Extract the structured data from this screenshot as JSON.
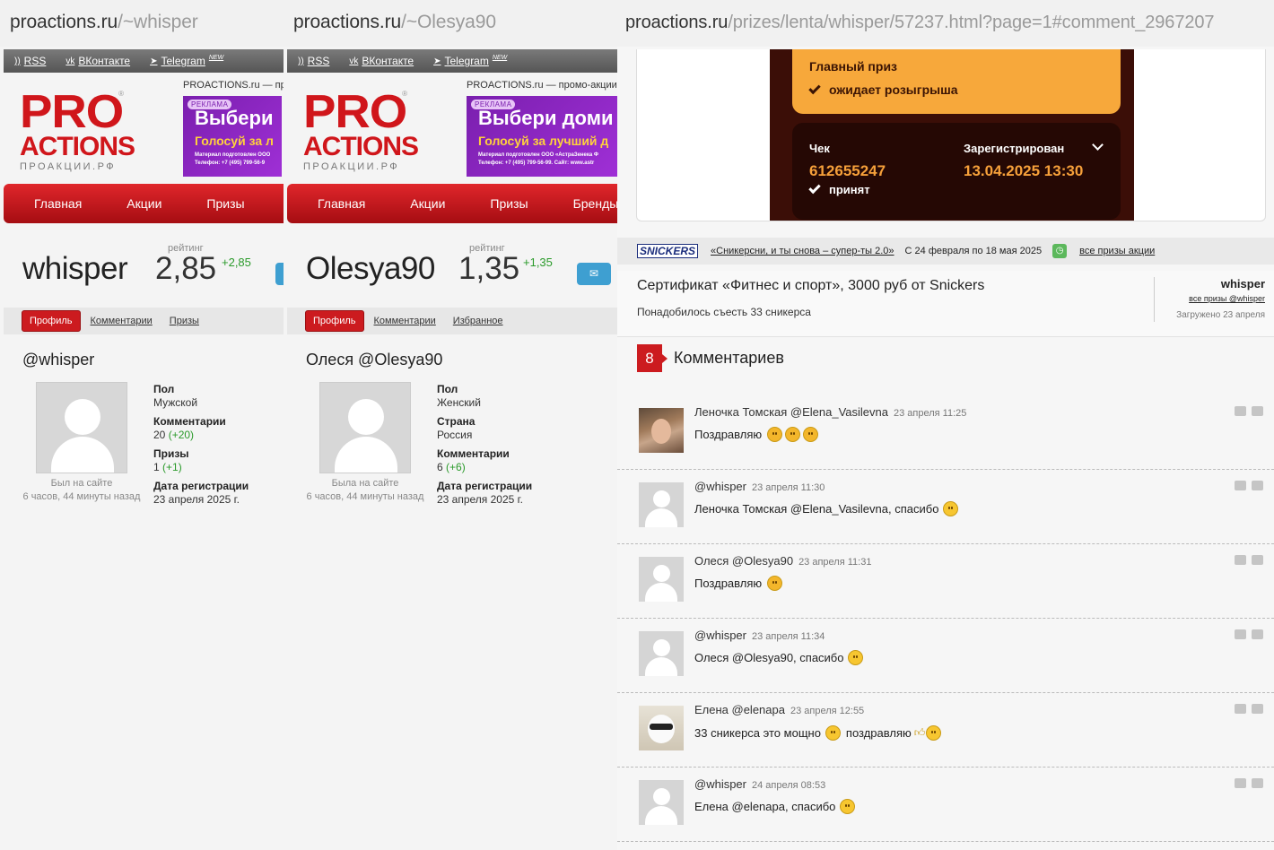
{
  "pane1": {
    "url_host": "proactions.ru",
    "url_path": "/~whisper",
    "topbar": {
      "rss": "RSS",
      "vk": "ВКонтакте",
      "telegram": "Telegram",
      "new": "NEW"
    },
    "logo": {
      "pro": "PRO",
      "actions": "ACTIONS",
      "ru": "ПРОАКЦИИ.РФ"
    },
    "tagline": "PROACTIONS.ru — пр",
    "ad": {
      "badge": "РЕКЛАМА",
      "line1": "Выбери",
      "line2": "Голосуй за л",
      "line3": "Материал подготовлен ООО",
      "line4": "Телефон: +7 (495) 799-56-9"
    },
    "nav": [
      "Главная",
      "Акции",
      "Призы"
    ],
    "username": "whisper",
    "rating_label": "рейтинг",
    "rating": "2,85",
    "rating_delta": "+2,85",
    "tabs": {
      "profile": "Профиль",
      "comments": "Комментарии",
      "third": "Призы"
    },
    "fullname": "@whisper",
    "seen": "Был на сайте",
    "seen_ago": "6 часов, 44 минуты назад",
    "info": [
      {
        "label": "Пол",
        "value": "Мужской"
      },
      {
        "label": "Комментарии",
        "value": "20",
        "delta": "(+20)"
      },
      {
        "label": "Призы",
        "value": "1",
        "delta": "(+1)"
      },
      {
        "label": "Дата регистрации",
        "value": "23 апреля 2025 г."
      }
    ]
  },
  "pane2": {
    "url_host": "proactions.ru",
    "url_path": "/~Olesya90",
    "topbar": {
      "rss": "RSS",
      "vk": "ВКонтакте",
      "telegram": "Telegram",
      "new": "NEW"
    },
    "logo": {
      "pro": "PRO",
      "actions": "ACTIONS",
      "ru": "ПРОАКЦИИ.РФ"
    },
    "tagline": "PROACTIONS.ru — промо-акции,",
    "ad": {
      "badge": "РЕКЛАМА",
      "line1": "Выбери доми",
      "line2": "Голосуй за лучший д",
      "line3": "Материал подготовлен ООО «АстраЗенека Ф",
      "line4": "Телефон: +7 (495) 799-56-99. Сайт: www.astr"
    },
    "nav": [
      "Главная",
      "Акции",
      "Призы",
      "Бренды"
    ],
    "username": "Olesya90",
    "rating_label": "рейтинг",
    "rating": "1,35",
    "rating_delta": "+1,35",
    "tabs": {
      "profile": "Профиль",
      "comments": "Комментарии",
      "third": "Избранное"
    },
    "fullname": "Олеся @Olesya90",
    "seen": "Была на сайте",
    "seen_ago": "6 часов, 44 минуты назад",
    "info": [
      {
        "label": "Пол",
        "value": "Женский"
      },
      {
        "label": "Страна",
        "value": "Россия"
      },
      {
        "label": "Комментарии",
        "value": "6",
        "delta": "(+6)"
      },
      {
        "label": "Дата регистрации",
        "value": "23 апреля 2025 г."
      }
    ]
  },
  "pane3": {
    "url_host": "proactions.ru",
    "url_path": "/prizes/lenta/whisper/57237.html?page=1#comment_2967207",
    "main_prize": "Главный приз",
    "main_prize_status": "ожидает розыгрыша",
    "check_label": "Чек",
    "check_number": "612655247",
    "check_status": "принят",
    "registered_label": "Зарегистрирован",
    "registered_value": "13.04.2025 13:30",
    "promo": {
      "brand": "SNICKERS",
      "name": "«Сникерсни, и ты снова – супер-ты 2.0»",
      "dates": "С 24 февраля по 18 мая 2025",
      "all_prizes": "все призы акции"
    },
    "prize": {
      "title": "Сертификат «Фитнес и спорт», 3000 руб от Snickers",
      "desc": "Понадобилось съесть 33 сникерса",
      "user": "whisper",
      "user_all": "все призы @whisper",
      "uploaded": "Загружено 23 апреля"
    },
    "comments_count": "8",
    "comments_label": "Комментариев",
    "comments": [
      {
        "author": "Леночка Томская @Elena_Vasilevna",
        "time": "23 апреля 11:25",
        "text": "Поздравляю"
      },
      {
        "author": "@whisper",
        "time": "23 апреля 11:30",
        "text": "Леночка Томская @Elena_Vasilevna, спасибо"
      },
      {
        "author": "Олеся @Olesya90",
        "time": "23 апреля 11:31",
        "text": "Поздравляю"
      },
      {
        "author": "@whisper",
        "time": "23 апреля 11:34",
        "text": "Олеся @Olesya90, спасибо"
      },
      {
        "author": "Елена @elenapa",
        "time": "23 апреля 12:55",
        "text": "33 сникерса это мощно",
        "text2": "поздравляю"
      },
      {
        "author": "@whisper",
        "time": "24 апреля 08:53",
        "text": "Елена @elenapa, спасибо"
      }
    ]
  }
}
